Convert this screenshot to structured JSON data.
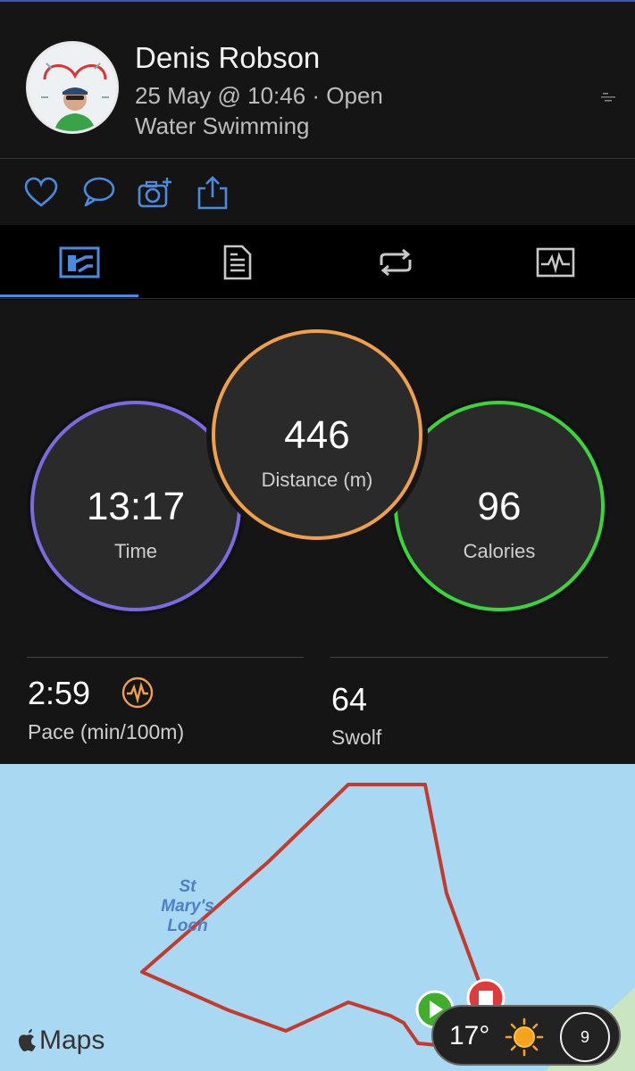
{
  "header": {
    "user_name": "Denis Robson",
    "date_line": "25 May @ 10:46 · Open",
    "activity_line": "Water Swimming"
  },
  "actions": [
    {
      "icon": "heart-icon"
    },
    {
      "icon": "comment-icon"
    },
    {
      "icon": "add-photo-icon"
    },
    {
      "icon": "share-icon"
    }
  ],
  "tabs": [
    {
      "icon": "overview-icon",
      "selected": true
    },
    {
      "icon": "details-icon",
      "selected": false
    },
    {
      "icon": "laps-icon",
      "selected": false
    },
    {
      "icon": "charts-icon",
      "selected": false
    }
  ],
  "rings": {
    "time": {
      "value": "13:17",
      "label": "Time",
      "color": "#7b6be3"
    },
    "distance": {
      "value": "446",
      "label": "Distance (m)",
      "color": "#f0a04a"
    },
    "calories": {
      "value": "96",
      "label": "Calories",
      "color": "#3bd43b"
    }
  },
  "metrics": {
    "pace": {
      "value": "2:59",
      "label": "Pace (min/100m)"
    },
    "swolf": {
      "value": "64",
      "label": "Swolf"
    }
  },
  "map": {
    "place_label": "St Mary's Loch",
    "place_lines": [
      "St",
      "Mary's",
      "Loch"
    ],
    "provider": "Maps",
    "weather_temp": "17°",
    "aqi_value": "9",
    "water_color": "#a9d8f2",
    "route_color": "#c43a2c"
  },
  "colors": {
    "accent": "#4a8bdf",
    "background": "#151515"
  }
}
